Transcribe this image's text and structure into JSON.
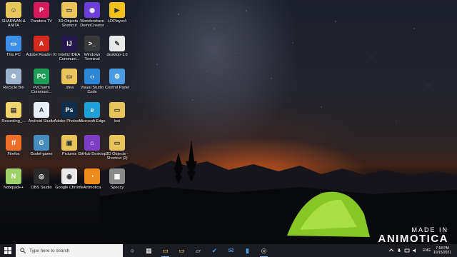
{
  "desktop": {
    "icons": [
      {
        "label": "SHARWAN & ANITA",
        "icon": "user-folder-icon"
      },
      {
        "label": "Pandora TV",
        "icon": "pandora-tv-icon"
      },
      {
        "label": "3D Objects - Shortcut",
        "icon": "folder-shortcut-icon"
      },
      {
        "label": "Wondershare DemoCreator",
        "icon": "democreator-icon"
      },
      {
        "label": "LDPlayer4",
        "icon": "ldplayer-icon"
      },
      {
        "label": "This PC",
        "icon": "this-pc-icon"
      },
      {
        "label": "Adobe Reader XI",
        "icon": "adobe-reader-icon"
      },
      {
        "label": "IntelliJ IDEA Communi...",
        "icon": "intellij-icon"
      },
      {
        "label": "Windows Terminal",
        "icon": "terminal-icon"
      },
      {
        "label": "desktop-1.0",
        "icon": "inkscape-icon"
      },
      {
        "label": "Recycle Bin",
        "icon": "recycle-bin-icon"
      },
      {
        "label": "PyCharm Communi...",
        "icon": "pycharm-icon"
      },
      {
        "label": ".idea",
        "icon": "folder-icon"
      },
      {
        "label": "Visual Studio Code",
        "icon": "vscode-icon"
      },
      {
        "label": "Control Panel",
        "icon": "control-panel-icon"
      },
      {
        "label": "Recording_...",
        "icon": "recording-file-icon"
      },
      {
        "label": "Android Studio",
        "icon": "android-studio-icon"
      },
      {
        "label": "Adobe Photosh...",
        "icon": "photoshop-icon"
      },
      {
        "label": "Microsoft Edge",
        "icon": "edge-icon"
      },
      {
        "label": "bot",
        "icon": "folder-icon"
      },
      {
        "label": "Firefox",
        "icon": "firefox-icon"
      },
      {
        "label": "Godot-game",
        "icon": "godot-icon"
      },
      {
        "label": "Pictures",
        "icon": "pictures-folder-icon"
      },
      {
        "label": "GitHub Desktop",
        "icon": "github-icon"
      },
      {
        "label": "3D Objects - Shortcut (2)",
        "icon": "folder-shortcut-icon"
      },
      {
        "label": "Notepad++",
        "icon": "notepadpp-icon"
      },
      {
        "label": "OBS Studio",
        "icon": "obs-icon"
      },
      {
        "label": "Google Chrome",
        "icon": "chrome-icon"
      },
      {
        "label": "Animotica",
        "icon": "animotica-icon"
      },
      {
        "label": "Speccy",
        "icon": "speccy-icon"
      }
    ]
  },
  "taskbar": {
    "search_placeholder": "Type here to search",
    "apps": [
      "task-view-icon",
      "cortana-icon",
      "file-explorer-icon",
      "folder-icon",
      "tablet-icon",
      "todo-icon",
      "mail-icon",
      "store-icon",
      "obs-icon"
    ],
    "language": "ENG",
    "time": "7:18 PM",
    "date": "10/15/2021"
  },
  "watermark": {
    "line1": "MADE IN",
    "line2": "ANIMOTICA"
  },
  "colors": {
    "taskbar": "#1b1c22",
    "search_box": "#f2f2f2",
    "tent": "#8fd12a"
  }
}
